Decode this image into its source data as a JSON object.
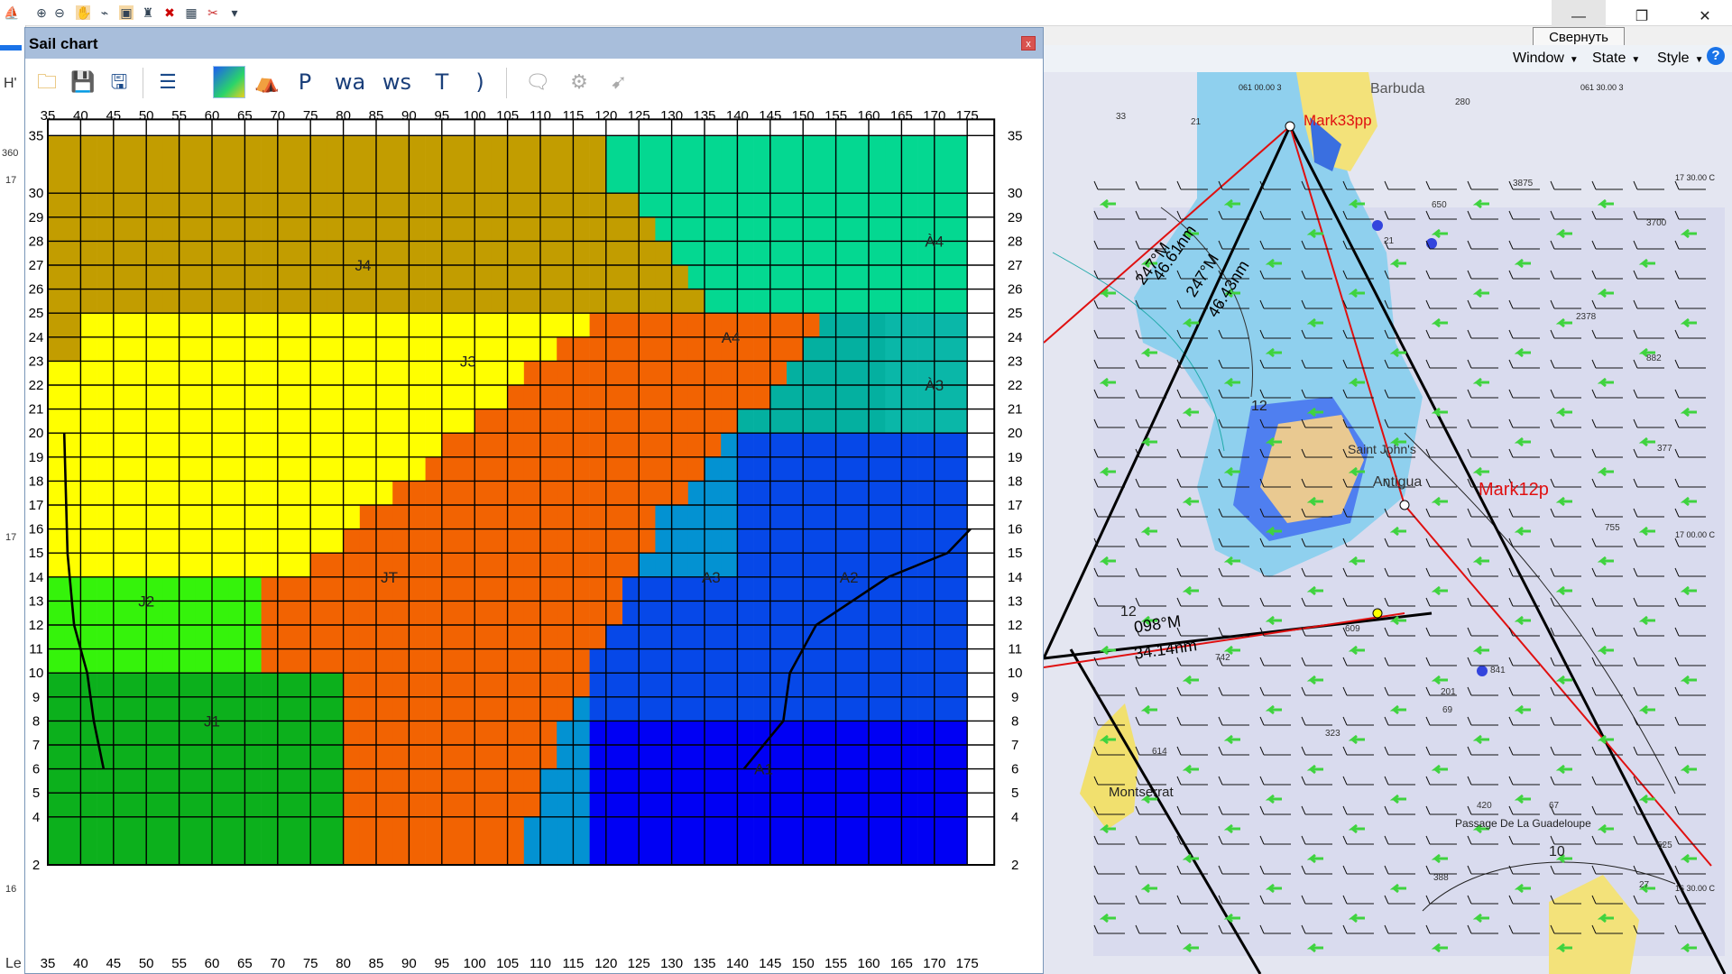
{
  "app": {
    "tooltip": "Свернуть",
    "menu": [
      "Window",
      "State",
      "Style"
    ],
    "help_icon": "question-icon",
    "toolbar_icons": [
      "sail-icon",
      "zoom-in-icon",
      "zoom-out-icon",
      "hand-icon",
      "route-icon",
      "window-icon",
      "boat-icon",
      "close-x-icon",
      "table-icon",
      "tools-icon",
      "more-icon"
    ],
    "left_strip_labels": [
      "H'",
      "360",
      "17",
      "17",
      "16",
      "Le"
    ]
  },
  "sail_chart": {
    "title": "Sail chart",
    "close_label": "x",
    "toolbar": {
      "icons": [
        "open-folder-icon",
        "save-icon",
        "save-as-icon",
        "list-icon",
        "color-map-icon",
        "sail-tent-icon"
      ],
      "text_tools": [
        "P",
        "wa",
        "ws",
        "T",
        ")"
      ],
      "disabled_icons": [
        "comment-icon",
        "gear-icon",
        "pointer-icon"
      ]
    }
  },
  "chart_data": {
    "type": "heatmap",
    "title": "",
    "xlabel": "",
    "ylabel": "",
    "x_ticks": [
      35,
      40,
      45,
      50,
      55,
      60,
      65,
      70,
      75,
      80,
      85,
      90,
      95,
      100,
      105,
      110,
      115,
      120,
      125,
      130,
      135,
      140,
      145,
      150,
      155,
      160,
      165,
      170,
      175
    ],
    "y_ticks": [
      2,
      4,
      5,
      6,
      7,
      8,
      9,
      10,
      11,
      12,
      13,
      14,
      15,
      16,
      17,
      18,
      19,
      20,
      21,
      22,
      23,
      24,
      25,
      26,
      27,
      28,
      29,
      30,
      35
    ],
    "xlim": [
      35,
      175
    ],
    "ylim": [
      2,
      35
    ],
    "grid": true,
    "sails": [
      {
        "name": "J1",
        "color": "#0cb01c"
      },
      {
        "name": "J2",
        "color": "#35f30b"
      },
      {
        "name": "J3",
        "color": "#ffff00"
      },
      {
        "name": "J4",
        "color": "#c29d00"
      },
      {
        "name": "JT",
        "color": "#f26302"
      },
      {
        "name": "A1",
        "color": "#0000f4"
      },
      {
        "name": "A2",
        "color": "#0648e8"
      },
      {
        "name": "A3",
        "color": "#0392d2"
      },
      {
        "name": "A4",
        "color": "#04b0a0"
      },
      {
        "name": "À3",
        "color": "#0ab7a8"
      },
      {
        "name": "À4",
        "color": "#04d891"
      }
    ],
    "labels": [
      {
        "text": "J4",
        "x": 83,
        "y": 27
      },
      {
        "text": "J3",
        "x": 99,
        "y": 23
      },
      {
        "text": "J2",
        "x": 50,
        "y": 13
      },
      {
        "text": "J1",
        "x": 60,
        "y": 8
      },
      {
        "text": "JT",
        "x": 87,
        "y": 14
      },
      {
        "text": "A4",
        "x": 139,
        "y": 24
      },
      {
        "text": "À4",
        "x": 170,
        "y": 28
      },
      {
        "text": "À3",
        "x": 170,
        "y": 22
      },
      {
        "text": "A3",
        "x": 136,
        "y": 14
      },
      {
        "text": "A2",
        "x": 157,
        "y": 14
      },
      {
        "text": "A1",
        "x": 144,
        "y": 6
      }
    ],
    "polar_curve_left": [
      [
        37.5,
        20
      ],
      [
        38,
        15
      ],
      [
        39,
        12
      ],
      [
        41,
        10
      ],
      [
        42,
        8
      ],
      [
        43.5,
        6
      ]
    ],
    "polar_curve_right": [
      [
        141,
        6
      ],
      [
        147,
        8
      ],
      [
        148,
        10
      ],
      [
        152,
        12
      ],
      [
        163,
        14
      ],
      [
        172,
        15
      ],
      [
        175.5,
        16
      ]
    ]
  },
  "map": {
    "labels": [
      "Barbuda",
      "Mark33pp",
      "Mark12p",
      "Saint John's",
      "Antigua",
      "247°M",
      "46.61nm",
      "247°M",
      "46.43nm",
      "098°M",
      "34.14nm",
      "Montserrat",
      "Passage De La Guadeloupe",
      "061 00.00 3",
      "061 30.00 3",
      "17 30.00 C",
      "17 00.00 C",
      "16 30.00 C",
      "12",
      "12",
      "10",
      "21",
      "33",
      "280",
      "650",
      "3875",
      "2378",
      "3700",
      "882",
      "377",
      "755",
      "21",
      "609",
      "323",
      "201",
      "69",
      "841",
      "742",
      "420",
      "525",
      "67",
      "388",
      "27",
      "614"
    ]
  }
}
